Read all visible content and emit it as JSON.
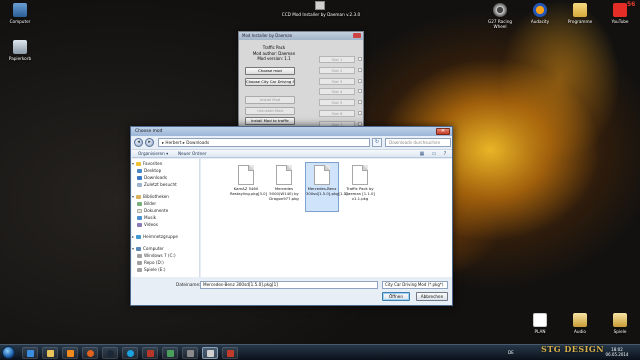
{
  "desktop": {
    "badge": "56",
    "icons": [
      {
        "name": "Computer",
        "icon": "computer-icon"
      },
      {
        "name": "Papierkorb",
        "icon": "recycle-bin-icon"
      },
      {
        "name": "G27 Racing Wheel",
        "icon": "steering-wheel-icon"
      },
      {
        "name": "Audacity",
        "icon": "audacity-icon"
      },
      {
        "name": "Programme",
        "icon": "folder-icon"
      },
      {
        "name": "YouTube",
        "icon": "youtube-icon"
      },
      {
        "name": "PLAN",
        "icon": "file-icon"
      },
      {
        "name": "Audio",
        "icon": "folder-icon"
      },
      {
        "name": "Spiele",
        "icon": "folder-icon"
      }
    ],
    "installer_icon_label": "CCD Mod Installer by Daeman v.2.3.0"
  },
  "installer": {
    "title": "Mod Installer by Daeman",
    "mod_name": "Traffic Pack",
    "mod_author": "Mod author: Daeman",
    "mod_version": "Mod version: 1.1",
    "buttons": [
      "Choose mod",
      "Choose City Car Driving folder",
      "Install Mod",
      "Uninstall Mod",
      "Install Mod to traffic",
      "Uninstall Mod from traffic"
    ],
    "slots": [
      "Slot 1",
      "Slot 2",
      "Slot 3",
      "Slot 4",
      "Slot 5",
      "Slot 6",
      "Slot 7"
    ]
  },
  "dialog": {
    "title": "Choose mod",
    "path": "▸ Herbert ▸ Downloads",
    "search_placeholder": "Downloads durchsuchen",
    "toolbar": {
      "organize": "Organisieren ▾",
      "new_folder": "Neuer Ordner"
    },
    "nav": {
      "favorites": "Favoriten",
      "desktop": "Desktop",
      "downloads": "Downloads",
      "recent": "Zuletzt besucht",
      "libraries": "Bibliotheken",
      "pictures": "Bilder",
      "documents": "Dokumente",
      "music": "Musik",
      "videos": "Videos",
      "homegroup": "Heimnetzgruppe",
      "computer": "Computer",
      "drive_c": "Windows 7 (C:)",
      "drive_d": "Repo (D:)",
      "drive_e": "Spiele (E:)",
      "network": "Netzwerk"
    },
    "files": [
      {
        "name": "KamAZ 5460 Restayling.pkg[3.0]"
      },
      {
        "name": "Mercedes 5000(W140) by Dragon977.pkg"
      },
      {
        "name": "Mercedes-Benz 300sd[1.5.0].pkg[1.1]"
      },
      {
        "name": "Traffic Pack by Daeman [1.1.0] v1.1.pkg"
      }
    ],
    "filename_label": "Dateiname:",
    "filename_value": "Mercedes-Benz 300sd[1.5.0].pkg[1]",
    "filetype": "City Car Driving Mod (*.pkg*)",
    "open_button": "Öffnen",
    "cancel_button": "Abbrechen"
  },
  "taskbar": {
    "language": "DE",
    "time": "18:02",
    "date": "06.05.2014",
    "brand": "STG DESIGN"
  }
}
